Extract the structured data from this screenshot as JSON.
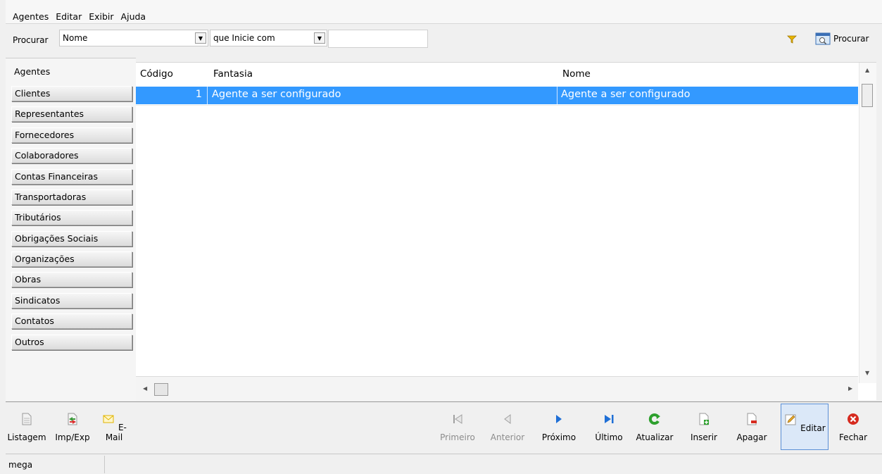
{
  "menu": [
    "Agentes",
    "Editar",
    "Exibir",
    "Ajuda"
  ],
  "search": {
    "label": "Procurar",
    "field_value": "Nome",
    "condition_value": "que Inicie com",
    "text_value": "",
    "button_label": "Procurar"
  },
  "categories": [
    "Agentes",
    "Clientes",
    "Representantes",
    "Fornecedores",
    "Colaboradores",
    "Contas Financeiras",
    "Transportadoras",
    "Tributários",
    "Obrigações Sociais",
    "Organizações",
    "Obras",
    "Sindicatos",
    "Contatos",
    "Outros"
  ],
  "grid": {
    "columns": [
      "Código",
      "Fantasia",
      "Nome"
    ],
    "rows": [
      {
        "codigo": "1",
        "fantasia": "Agente a ser configurado",
        "nome": "Agente a ser configurado"
      }
    ]
  },
  "toolbar": {
    "listagem": "Listagem",
    "impexp": "Imp/Exp",
    "email": "E-Mail",
    "primeiro": "Primeiro",
    "anterior": "Anterior",
    "proximo": "Próximo",
    "ultimo": "Último",
    "atualizar": "Atualizar",
    "inserir": "Inserir",
    "apagar": "Apagar",
    "editar": "Editar",
    "fechar": "Fechar"
  },
  "status": "mega",
  "colors": {
    "selection": "#3399ff",
    "refresh_green": "#2ea02e",
    "close_red": "#d62b1f",
    "nav_blue": "#1f6fd6",
    "email_yellow": "#e7c12c"
  }
}
